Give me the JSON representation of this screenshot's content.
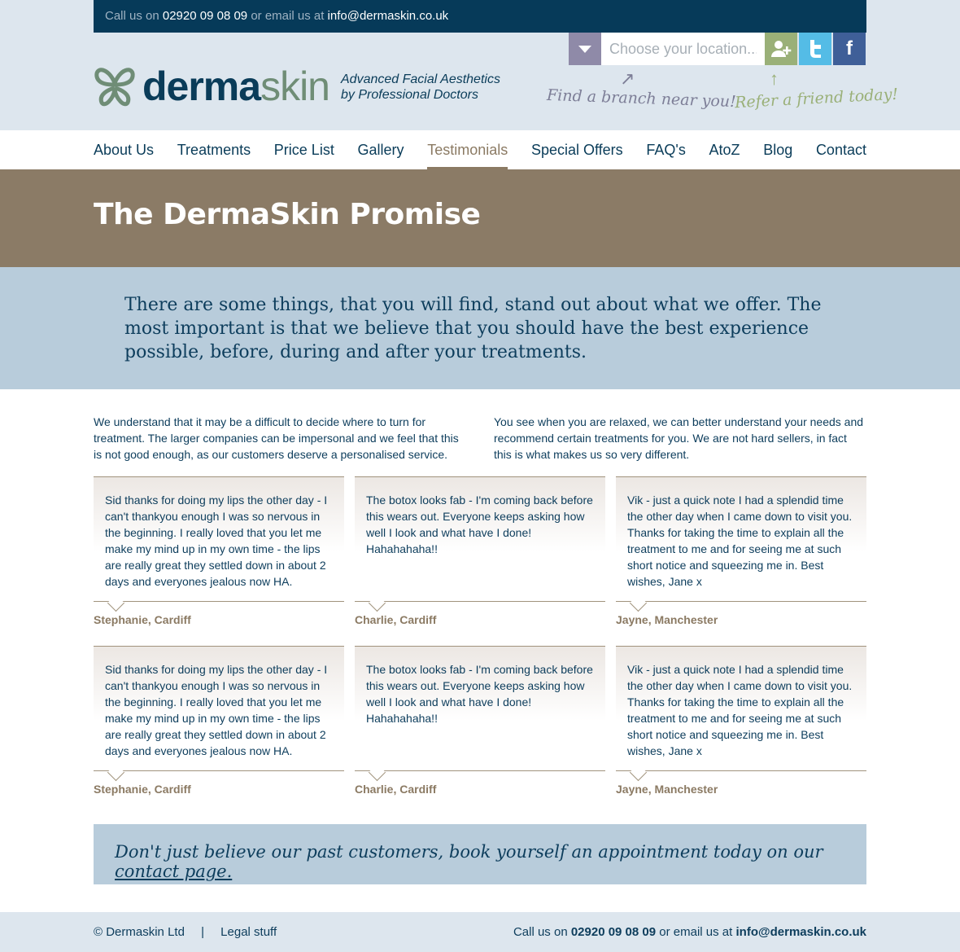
{
  "topbar": {
    "call_prefix": "Call us on",
    "phone": "02920 09 08 09",
    "email_prefix": "or email us at",
    "email": "info@dermaskin.co.uk"
  },
  "location": {
    "placeholder": "Choose your location...",
    "hint": "Find a branch near you!"
  },
  "refer": {
    "hint": "Refer a friend today!"
  },
  "logo": {
    "word_a": "derma",
    "word_b": "skin",
    "tagline_1": "Advanced Facial Aesthetics",
    "tagline_2": "by Professional Doctors"
  },
  "nav": [
    {
      "label": "About Us"
    },
    {
      "label": "Treatments"
    },
    {
      "label": "Price List"
    },
    {
      "label": "Gallery"
    },
    {
      "label": "Testimonials",
      "active": true
    },
    {
      "label": "Special Offers"
    },
    {
      "label": "FAQ's"
    },
    {
      "label": "AtoZ"
    },
    {
      "label": "Blog"
    },
    {
      "label": "Contact"
    }
  ],
  "hero": {
    "title": "The DermaSkin Promise"
  },
  "intro": "There are some things, that you will find, stand out about what we offer. The most important is that we believe that you should have the best experience possible, before, during and after your treatments.",
  "columns": [
    "We understand that it may be a difficult to decide where to turn for treatment. The larger companies can be impersonal and we feel that this is not good enough, as our customers deserve a personalised service.",
    "You see when you are relaxed, we can better understand your needs and recommend certain treatments for you. We are not hard sellers, in fact this is what makes us so very different."
  ],
  "testimonials": [
    {
      "text": "Sid thanks for doing my lips the other day - I can't thankyou enough I was so nervous in the beginning.  I really loved that you let me make my mind up in my own time - the lips are really great they settled down in about 2 days and everyones jealous now HA.",
      "author": "Stephanie, Cardiff"
    },
    {
      "text": "The botox looks fab - I'm coming back before this wears out.  Everyone keeps asking how well I look and what have I done! Hahahahaha!!",
      "author": "Charlie, Cardiff"
    },
    {
      "text": "Vik - just a quick note I had a splendid time the other day when I came down to visit you. Thanks for taking the time to explain all the treatment to me and for seeing me at such short notice and squeezing me in.  Best wishes, Jane x",
      "author": "Jayne, Manchester"
    },
    {
      "text": "Sid thanks for doing my lips the other day - I can't thankyou enough I was so nervous in the beginning.  I really loved that you let me make my mind up in my own time - the lips are really great they settled down in about 2 days and everyones jealous now HA.",
      "author": "Stephanie, Cardiff"
    },
    {
      "text": "The botox looks fab - I'm coming back before this wears out.  Everyone keeps asking how well I look and what have I done! Hahahahaha!!",
      "author": "Charlie, Cardiff"
    },
    {
      "text": "Vik - just a quick note I had a splendid time the other day when I came down to visit you. Thanks for taking the time to explain all the treatment to me and for seeing me at such short notice and squeezing me in.  Best wishes, Jane x",
      "author": "Jayne, Manchester"
    }
  ],
  "cta": {
    "text": "Don't just believe our past customers, book yourself an appointment today on our",
    "link": "contact page."
  },
  "footer": {
    "copyright": "© Dermaskin Ltd",
    "separator": "|",
    "legal": "Legal stuff",
    "call_prefix": "Call us on",
    "phone": "02920 09 08 09",
    "email_prefix": "or email us at",
    "email": "info@dermaskin.co.uk"
  }
}
